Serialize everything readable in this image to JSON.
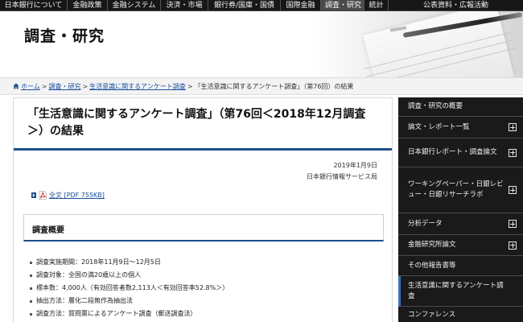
{
  "topnav": {
    "items": [
      {
        "label": "日本銀行について"
      },
      {
        "label": "金融政策"
      },
      {
        "label": "金融システム"
      },
      {
        "label": "決済・市場"
      },
      {
        "label": "銀行券/国庫・国債"
      },
      {
        "label": "国際金融"
      },
      {
        "label": "調査・研究"
      },
      {
        "label": "統計"
      },
      {
        "label": "公表資料・広報活動"
      }
    ]
  },
  "header": {
    "title": "調査・研究"
  },
  "breadcrumb": {
    "home": "ホーム",
    "level1": "調査・研究",
    "level2": "生活意識に関するアンケート調査",
    "current": "「生活意識に関するアンケート調査」（第76回）の結果",
    "separator": ">"
  },
  "article": {
    "title": "「生活意識に関するアンケート調査」（第76回＜2018年12月調査＞）の結果",
    "date": "2019年1月9日",
    "department": "日本銀行情報サービス局",
    "pdf_link": "全文 [PDF 755KB]",
    "overview_heading": "調査概要",
    "items": [
      "調査実施期間：2018年11月9日～12月5日",
      "調査対象：全国の満20歳以上の個人",
      "標本数：4,000人（有効回答者数2,113人＜有効回答率52.8%＞）",
      "抽出方法：層化二段無作為抽出法",
      "調査方法：質問票によるアンケート調査（郵送調査法）"
    ]
  },
  "sidebar": {
    "items": [
      {
        "label": "調査・研究の概要"
      },
      {
        "label": "論文・レポート一覧"
      },
      {
        "label": "日本銀行レポート・調査論文"
      },
      {
        "label": "ワーキングペーパー・日銀レビュー・日銀リサーチラボ"
      },
      {
        "label": "分析データ"
      },
      {
        "label": "金融研究所論文"
      },
      {
        "label": "その他報告書等"
      },
      {
        "label": "生活意識に関するアンケート調査"
      },
      {
        "label": "コンファレンス"
      }
    ]
  },
  "colors": {
    "nav_bg": "#171717",
    "accent_blue": "#1f4f8a",
    "link": "#1a4fa0",
    "sidebar_bg": "#1a1a1a"
  }
}
